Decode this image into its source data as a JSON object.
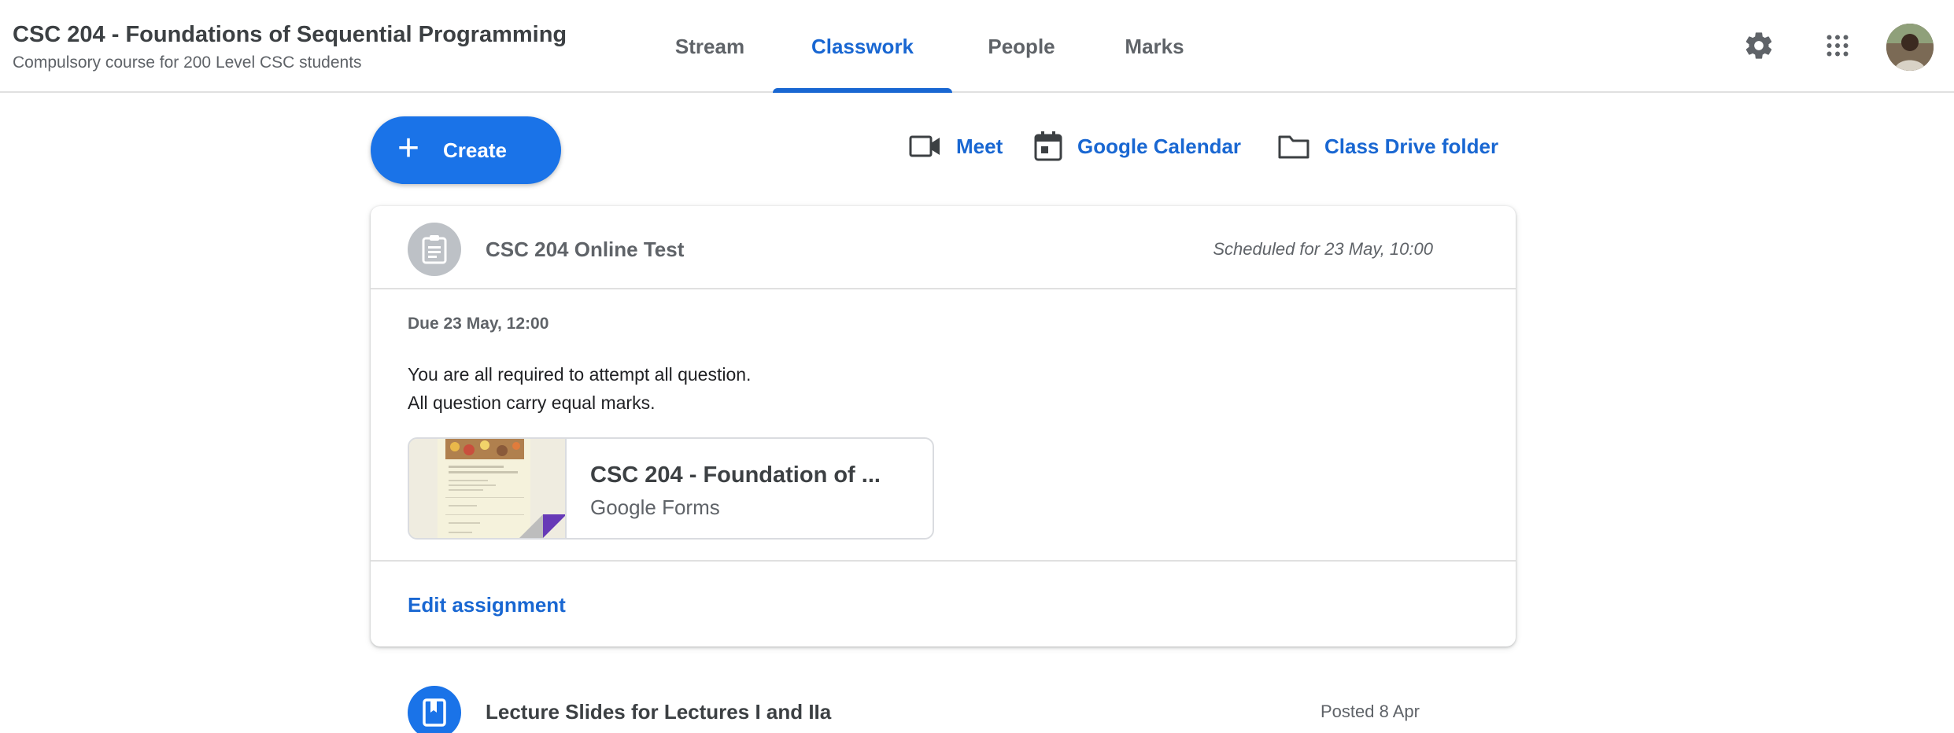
{
  "header": {
    "class_title": "CSC 204 - Foundations of Sequential Programming",
    "class_subtitle": "Compulsory course for 200 Level CSC students",
    "tabs": [
      {
        "label": "Stream",
        "active": false
      },
      {
        "label": "Classwork",
        "active": true
      },
      {
        "label": "People",
        "active": false
      },
      {
        "label": "Marks",
        "active": false
      }
    ],
    "icons": [
      "gear-icon",
      "apps-grid-icon",
      "avatar"
    ]
  },
  "toolbar": {
    "create_label": "Create",
    "meet_label": "Meet",
    "calendar_label": "Google Calendar",
    "drive_label": "Class Drive folder"
  },
  "assignment": {
    "title": "CSC 204 Online Test",
    "scheduled": "Scheduled for 23 May, 10:00",
    "due": "Due 23 May, 12:00",
    "description_lines": [
      "You are all required to attempt all question.",
      "All question carry equal marks."
    ],
    "attachment": {
      "title": "CSC 204 - Foundation of ...",
      "type": "Google Forms"
    },
    "edit_label": "Edit assignment"
  },
  "items": [
    {
      "title": "Lecture Slides for Lectures I and IIa",
      "posted": "Posted 8 Apr"
    }
  ],
  "colors": {
    "accent": "#1967d2",
    "button": "#1a73e8",
    "assignment_icon": "#bdc1c6",
    "forms_purple": "#673ab7"
  }
}
